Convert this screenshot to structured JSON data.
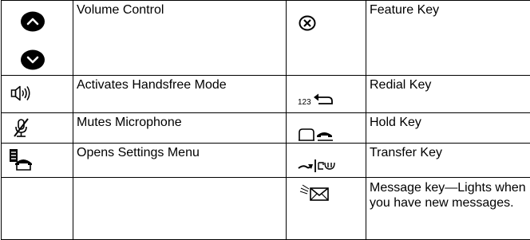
{
  "rows": [
    {
      "left_icon": "volume-up-down-icon",
      "left_label": "Volume Control",
      "right_icon": "feature-x-icon",
      "right_label": "Feature Key"
    },
    {
      "left_icon": "speaker-icon",
      "left_label": "Activates Handsfree Mode",
      "right_icon": "redial-icon",
      "right_label": "Redial Key"
    },
    {
      "left_icon": "muted-mic-icon",
      "left_label": "Mutes Microphone",
      "right_icon": "hold-icon",
      "right_label": "Hold Key"
    },
    {
      "left_icon": "settings-phone-icon",
      "left_label": "Opens Settings Menu",
      "right_icon": "transfer-icon",
      "right_label": "Transfer Key"
    },
    {
      "left_icon": "",
      "left_label": "",
      "right_icon": "message-envelope-icon",
      "right_label": "Message key—Lights when you have new messages."
    }
  ],
  "icon_texts": {
    "redial_digits": "123"
  }
}
